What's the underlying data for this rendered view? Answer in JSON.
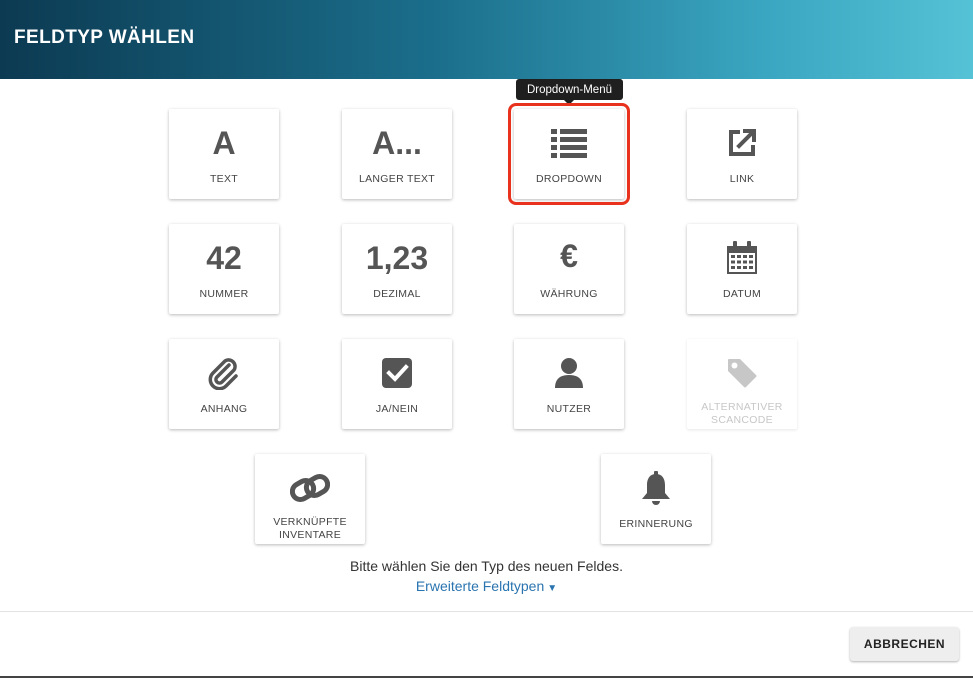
{
  "dialog": {
    "title": "FELDTYP WÄHLEN"
  },
  "tooltip": {
    "text": "Dropdown-Menü"
  },
  "tiles": {
    "text": {
      "glyph": "A",
      "label": "TEXT"
    },
    "long_text": {
      "glyph": "A...",
      "label": "LANGER TEXT"
    },
    "dropdown": {
      "icon": "list-icon",
      "label": "DROPDOWN",
      "selected": true
    },
    "link": {
      "icon": "external-link-icon",
      "label": "LINK"
    },
    "number": {
      "glyph": "42",
      "label": "NUMMER"
    },
    "decimal": {
      "glyph": "1,23",
      "label": "DEZIMAL"
    },
    "currency": {
      "glyph": "€",
      "label": "WÄHRUNG"
    },
    "date": {
      "icon": "calendar-icon",
      "label": "DATUM"
    },
    "attachment": {
      "icon": "paperclip-icon",
      "label": "ANHANG"
    },
    "yes_no": {
      "icon": "checkbox-icon",
      "label": "JA/NEIN"
    },
    "user": {
      "icon": "user-icon",
      "label": "NUTZER"
    },
    "alt_scancode": {
      "icon": "tag-icon",
      "label_line1": "ALTERNATIVER",
      "label_line2": "SCANCODE",
      "disabled": true
    },
    "linked_inventory": {
      "icon": "chain-link-icon",
      "label_line1": "VERKNÜPFTE",
      "label_line2": "INVENTARE"
    },
    "reminder": {
      "icon": "bell-icon",
      "label": "ERINNERUNG"
    }
  },
  "hint": "Bitte wählen Sie den Typ des neuen Feldes.",
  "advanced_link": "Erweiterte Feldtypen",
  "cancel_button": "ABBRECHEN",
  "colors": {
    "accent_link": "#2a74b0",
    "selection_outline": "#e8321e",
    "header_start": "#0c3a52",
    "header_end": "#55c2d6"
  }
}
